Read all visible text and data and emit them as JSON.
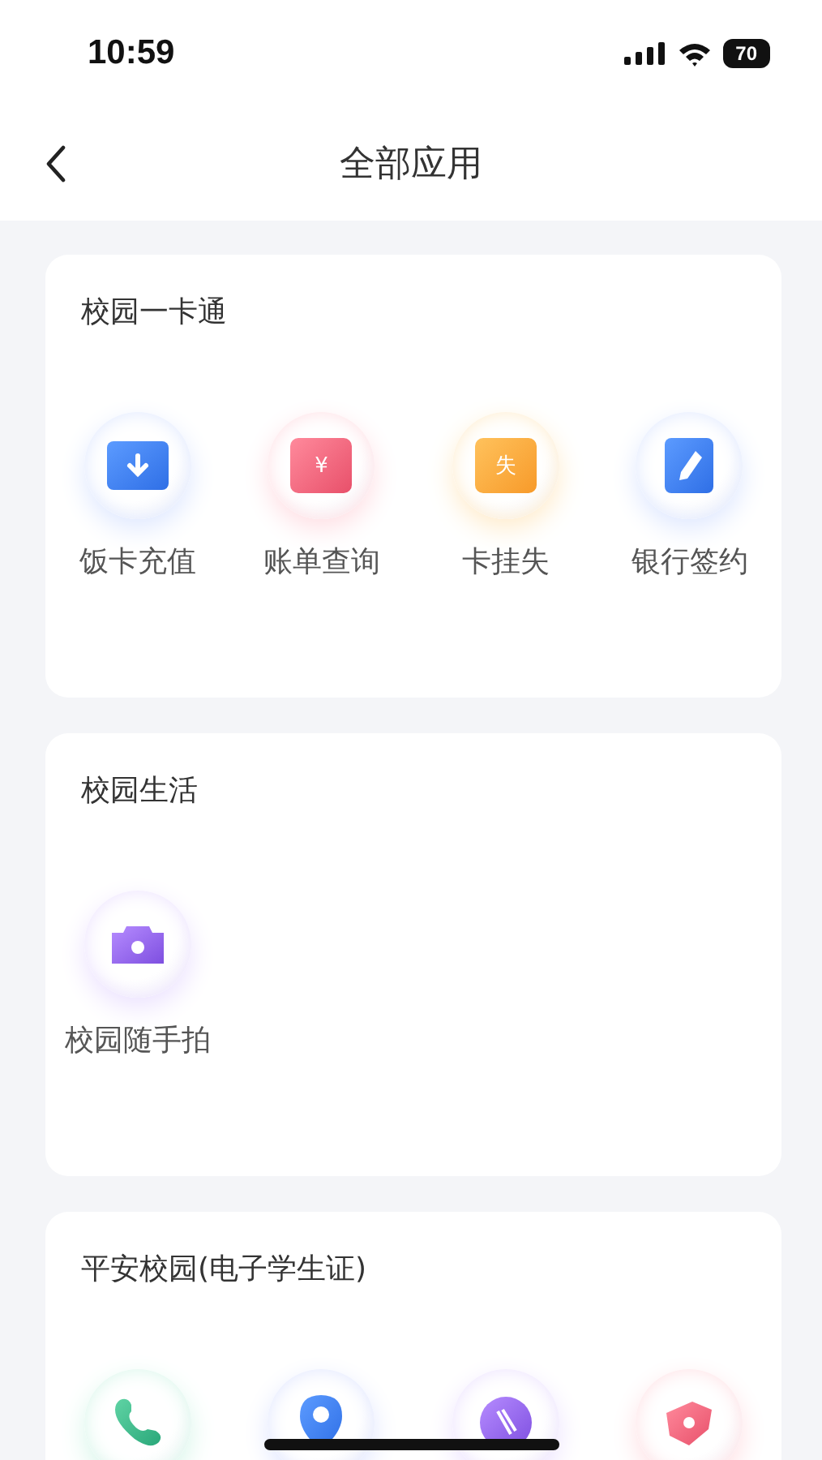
{
  "status_bar": {
    "time": "10:59",
    "battery": "70"
  },
  "header": {
    "title": "全部应用"
  },
  "sections": [
    {
      "title": "校园一卡通",
      "apps": [
        {
          "kind": "recharge",
          "label": "饭卡充值"
        },
        {
          "kind": "bill",
          "label": "账单查询",
          "glyph": "¥"
        },
        {
          "kind": "lost",
          "label": "卡挂失",
          "glyph": "失"
        },
        {
          "kind": "sign",
          "label": "银行签约"
        }
      ]
    },
    {
      "title": "校园生活",
      "apps": [
        {
          "kind": "camera",
          "label": "校园随手拍"
        }
      ]
    },
    {
      "title": "平安校园(电子学生证)",
      "apps": [
        {
          "kind": "phone"
        },
        {
          "kind": "location"
        },
        {
          "kind": "link"
        },
        {
          "kind": "alert"
        }
      ]
    }
  ]
}
